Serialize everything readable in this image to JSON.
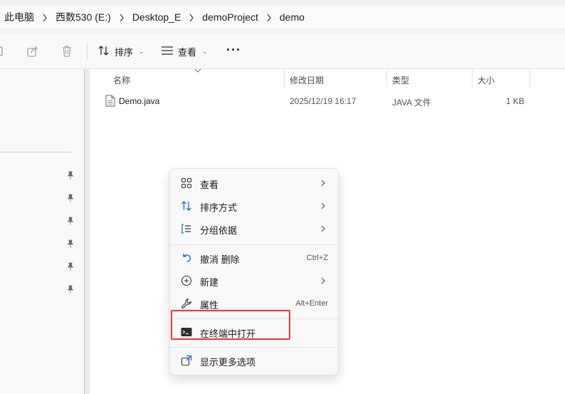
{
  "breadcrumbs": [
    "此电脑",
    "西数530 (E:)",
    "Desktop_E",
    "demoProject",
    "demo"
  ],
  "toolbar": {
    "sort_label": "排序",
    "view_label": "查看",
    "more_label": "···"
  },
  "columns": {
    "name": "名称",
    "modified": "修改日期",
    "type": "类型",
    "size": "大小"
  },
  "files": [
    {
      "name": "Demo.java",
      "modified": "2025/12/19 16:17",
      "type": "JAVA 文件",
      "size": "1 KB"
    }
  ],
  "menu": {
    "view": "查看",
    "sort": "排序方式",
    "group": "分组依据",
    "undo": "撤消 删除",
    "undo_key": "Ctrl+Z",
    "new": "新建",
    "properties": "属性",
    "properties_key": "Alt+Enter",
    "terminal": "在终端中打开",
    "more_options": "显示更多选项"
  },
  "colors": {
    "accent": "#0067c0",
    "highlight_box": "#e53935"
  }
}
